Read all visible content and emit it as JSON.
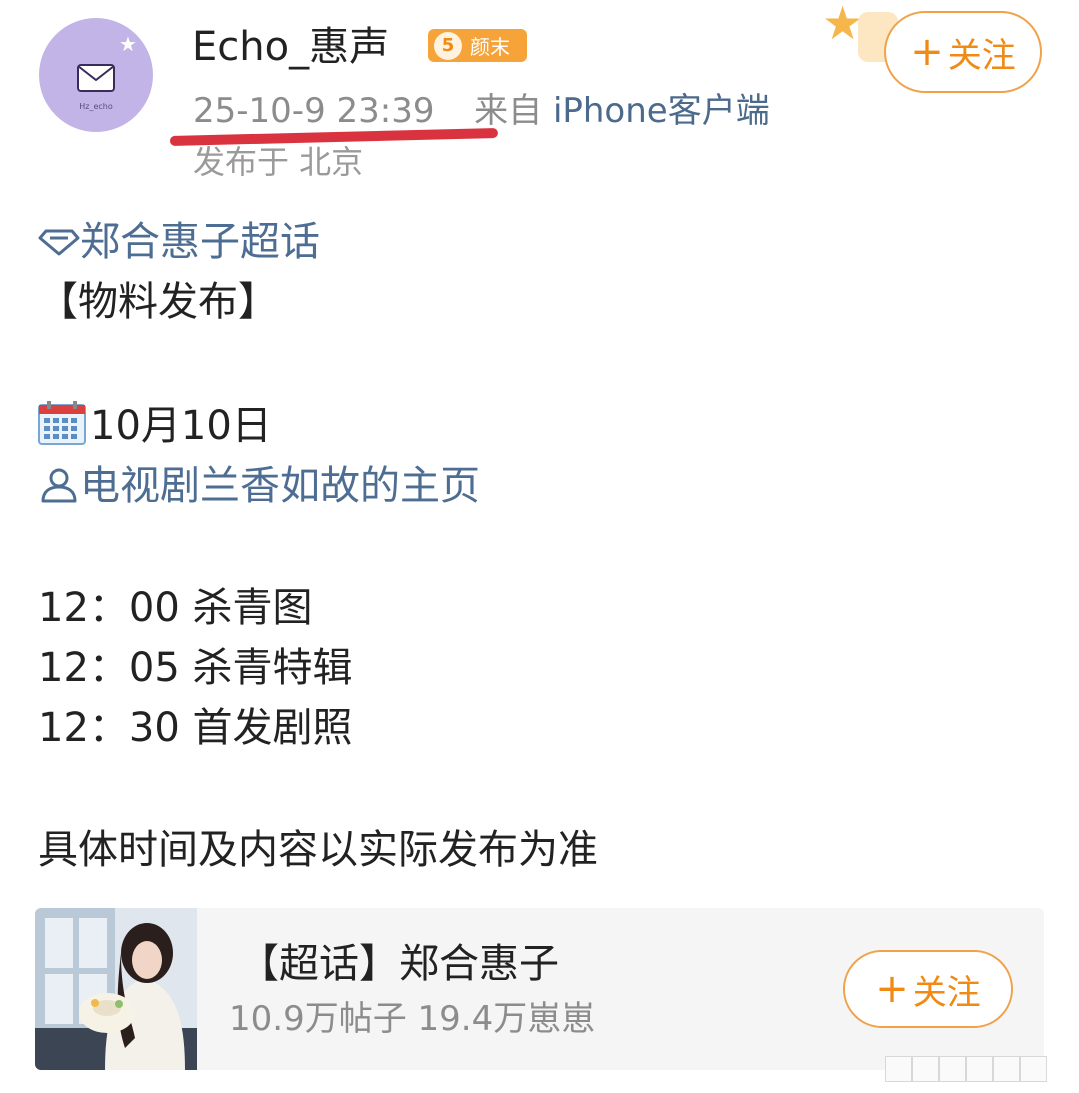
{
  "author": {
    "name": "Echo_惠声",
    "level": "5",
    "level_name": "颜末",
    "avatar_text": "Hz_echo",
    "follow_label": "关注"
  },
  "post_meta": {
    "time": "25-10-9 23:39",
    "source_prefix": "来自",
    "source": "iPhone客户端",
    "location": "发布于 北京"
  },
  "content": {
    "supertopic_link": "郑合惠子超话",
    "heading": "【物料发布】",
    "date": "10月10日",
    "page_link": "电视剧兰香如故的主页",
    "schedule": [
      "12：00 杀青图",
      "12：05 杀青特辑",
      "12：30 首发剧照"
    ],
    "note": "具体时间及内容以实际发布为准"
  },
  "topic_card": {
    "title": "【超话】郑合惠子",
    "stats": "10.9万帖子 19.4万崽崽",
    "follow_label": "关注"
  },
  "icons": {
    "supertopic": "diamond-icon",
    "calendar": "calendar-icon",
    "user": "user-icon",
    "mail": "envelope-icon"
  },
  "colors": {
    "accent_orange": "#f08a14",
    "link_blue": "#4d6d93",
    "highlight_red": "#d9333f"
  }
}
